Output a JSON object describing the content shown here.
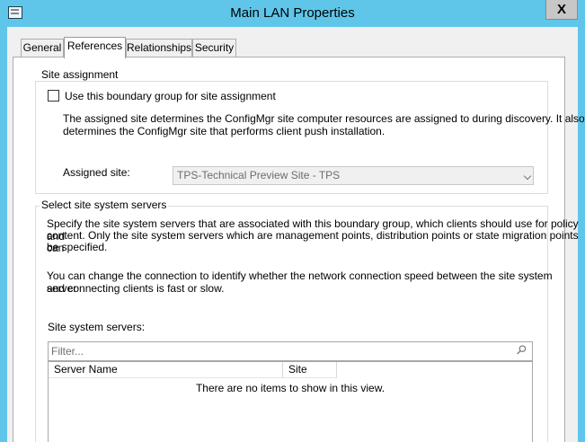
{
  "window": {
    "title": "Main LAN Properties",
    "close_glyph": "X"
  },
  "tabs": [
    {
      "label": "General",
      "active": false
    },
    {
      "label": "References",
      "active": true
    },
    {
      "label": "Relationships",
      "active": false
    },
    {
      "label": "Security",
      "active": false
    }
  ],
  "site_assignment": {
    "group_title": "Site assignment",
    "checkbox_label": "Use this boundary group for site assignment",
    "checkbox_checked": false,
    "description_line1": "The assigned site determines the ConfigMgr site computer resources are assigned to during discovery. It also",
    "description_line2": "determines the ConfigMgr site that performs client push installation.",
    "assigned_site_label": "Assigned site:",
    "assigned_site_value": "TPS-Technical Preview Site - TPS"
  },
  "site_system_servers": {
    "group_title": "Select site system servers",
    "description1_line1": "Specify the site system servers that are associated with this boundary group, which clients should use for policy and",
    "description1_line2": "content. Only the site system servers which are management points, distribution points or state migration points can",
    "description1_line3": "be specified.",
    "description2_line1": "You can change the connection to identify whether the network connection speed between the site system server",
    "description2_line2": "and connecting clients is fast or slow.",
    "list_label": "Site system servers:",
    "filter_placeholder": "Filter...",
    "columns": [
      "Server Name",
      "Site"
    ],
    "empty_message": "There are no items to show in this view."
  },
  "icons": {
    "window": "window-icon",
    "close": "close-icon",
    "search": "search-icon",
    "dropdown": "chevron-down-icon"
  },
  "colors": {
    "titlebar": "#5fc6ea",
    "dialog_bg": "#f0f0f0",
    "panel_bg": "#ffffff",
    "disabled_text": "#6d6d6d"
  }
}
